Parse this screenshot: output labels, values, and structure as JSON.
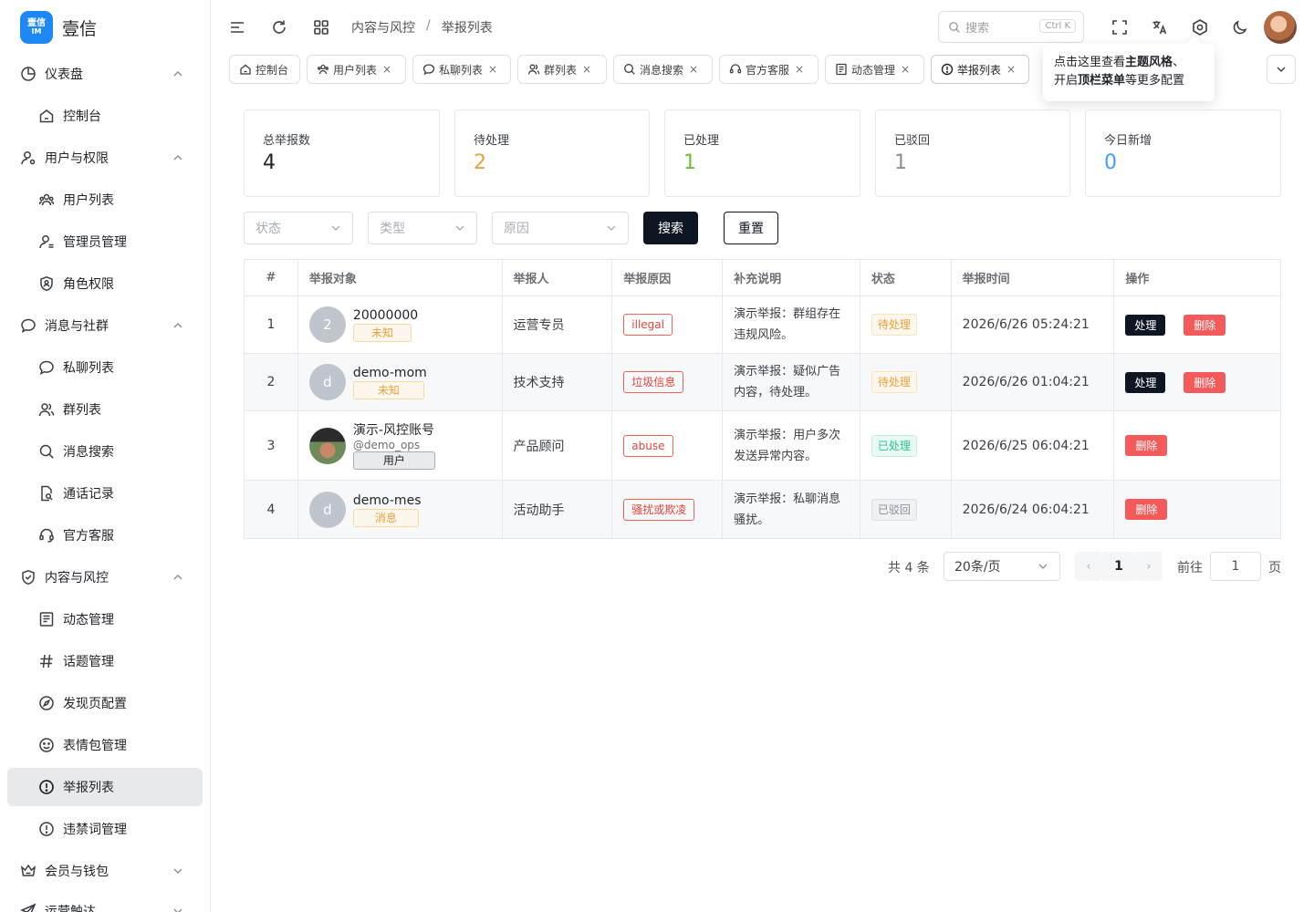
{
  "app": {
    "name": "壹信",
    "logo_text_top": "壹信",
    "logo_text_bottom": "IM"
  },
  "sidebar": {
    "groups": [
      {
        "label": "仪表盘",
        "children": [
          {
            "label": "控制台"
          }
        ]
      },
      {
        "label": "用户与权限",
        "children": [
          {
            "label": "用户列表"
          },
          {
            "label": "管理员管理"
          },
          {
            "label": "角色权限"
          }
        ]
      },
      {
        "label": "消息与社群",
        "children": [
          {
            "label": "私聊列表"
          },
          {
            "label": "群列表"
          },
          {
            "label": "消息搜索"
          },
          {
            "label": "通话记录"
          },
          {
            "label": "官方客服"
          }
        ]
      },
      {
        "label": "内容与风控",
        "children": [
          {
            "label": "动态管理"
          },
          {
            "label": "话题管理"
          },
          {
            "label": "发现页配置"
          },
          {
            "label": "表情包管理"
          },
          {
            "label": "举报列表"
          },
          {
            "label": "违禁词管理"
          }
        ]
      },
      {
        "label": "会员与钱包",
        "children": []
      },
      {
        "label": "运营触达",
        "children": []
      }
    ]
  },
  "header": {
    "breadcrumb": [
      "内容与风控",
      "举报列表"
    ],
    "breadcrumb_sep": "/",
    "search_placeholder": "搜索",
    "search_shortcut": "Ctrl K"
  },
  "tabs": [
    {
      "label": "控制台",
      "closable": false,
      "icon": "home-icon"
    },
    {
      "label": "用户列表",
      "closable": true,
      "icon": "users-icon"
    },
    {
      "label": "私聊列表",
      "closable": true,
      "icon": "chat-icon"
    },
    {
      "label": "群列表",
      "closable": true,
      "icon": "group-icon"
    },
    {
      "label": "消息搜索",
      "closable": true,
      "icon": "search-icon"
    },
    {
      "label": "官方客服",
      "closable": true,
      "icon": "headset-icon"
    },
    {
      "label": "动态管理",
      "closable": true,
      "icon": "doc-icon"
    },
    {
      "label": "举报列表",
      "closable": true,
      "icon": "alert-icon"
    }
  ],
  "tab_close_glyph": "×",
  "tooltip": {
    "part1": "点击这里查看",
    "bold1": "主题风格",
    "part2": "、",
    "part3": "开启",
    "bold2": "顶栏菜单",
    "part4": "等更多配置"
  },
  "stats": [
    {
      "label": "总举报数",
      "value": "4",
      "color": "#1f2329"
    },
    {
      "label": "待处理",
      "value": "2",
      "color": "#e6a23c"
    },
    {
      "label": "已处理",
      "value": "1",
      "color": "#67c23a"
    },
    {
      "label": "已驳回",
      "value": "1",
      "color": "#8a8f96"
    },
    {
      "label": "今日新增",
      "value": "0",
      "color": "#409eff"
    }
  ],
  "filters": {
    "status_placeholder": "状态",
    "type_placeholder": "类型",
    "reason_placeholder": "原因",
    "search_label": "搜索",
    "reset_label": "重置"
  },
  "table": {
    "columns": [
      "#",
      "举报对象",
      "举报人",
      "举报原因",
      "补充说明",
      "状态",
      "举报时间",
      "操作"
    ],
    "rows": [
      {
        "no": "1",
        "avatar": "2",
        "name": "20000000",
        "sub": "",
        "type": "未知",
        "reporter": "运营专员",
        "reason": "illegal",
        "note": "演示举报：群组存在违规风险。",
        "status": "待处理",
        "time": "2026/6/26 05:24:21",
        "can_process": true
      },
      {
        "no": "2",
        "avatar": "d",
        "name": "demo-mom",
        "sub": "",
        "type": "未知",
        "reporter": "技术支持",
        "reason": "垃圾信息",
        "note": "演示举报：疑似广告内容，待处理。",
        "status": "待处理",
        "time": "2026/6/26 01:04:21",
        "can_process": true
      },
      {
        "no": "3",
        "avatar": "",
        "name": "演示-风控账号",
        "sub": "@demo_ops",
        "type": "用户",
        "reporter": "产品顾问",
        "reason": "abuse",
        "note": "演示举报：用户多次发送异常内容。",
        "status": "已处理",
        "time": "2026/6/25 06:04:21",
        "can_process": false
      },
      {
        "no": "4",
        "avatar": "d",
        "name": "demo-mes",
        "sub": "",
        "type": "消息",
        "reporter": "活动助手",
        "reason": "骚扰或欺凌",
        "note": "演示举报：私聊消息骚扰。",
        "status": "已驳回",
        "time": "2026/6/24 06:04:21",
        "can_process": false
      }
    ],
    "process_label": "处理",
    "delete_label": "删除"
  },
  "pagination": {
    "total": "共 4 条",
    "page_size": "20条/页",
    "prev": "‹",
    "current": "1",
    "next": "›",
    "goto": "前往",
    "goto_value": "1",
    "page_suffix": "页"
  }
}
